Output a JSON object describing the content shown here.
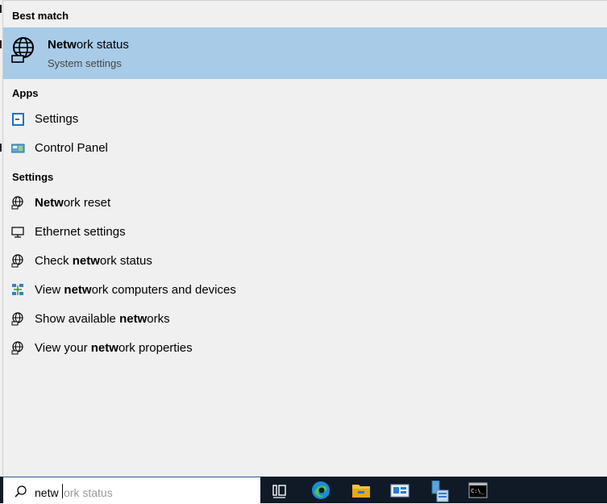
{
  "sections": {
    "best_match": "Best match",
    "apps": "Apps",
    "settings": "Settings"
  },
  "best_match": {
    "title_bold": "Netw",
    "title_rest": "ork status",
    "subtitle": "System settings"
  },
  "apps": [
    {
      "label": "Settings",
      "icon": "settings-app-icon"
    },
    {
      "label": "Control Panel",
      "icon": "control-panel-icon"
    }
  ],
  "settings": [
    {
      "pre": "",
      "bold": "Netw",
      "post": "ork reset",
      "icon": "globe-icon"
    },
    {
      "pre": "Ethernet settings",
      "bold": "",
      "post": "",
      "icon": "ethernet-icon"
    },
    {
      "pre": "Check ",
      "bold": "netw",
      "post": "ork status",
      "icon": "globe-icon"
    },
    {
      "pre": "View ",
      "bold": "netw",
      "post": "ork computers and devices",
      "icon": "network-devices-icon"
    },
    {
      "pre": "Show available ",
      "bold": "netw",
      "post": "orks",
      "icon": "globe-icon"
    },
    {
      "pre": "View your ",
      "bold": "netw",
      "post": "ork properties",
      "icon": "globe-icon"
    }
  ],
  "search": {
    "typed": "netw",
    "suggestion": "ork status"
  },
  "taskbar": [
    "task-view-icon",
    "edge-icon",
    "file-explorer-icon",
    "server-manager-icon",
    "admin-tools-icon",
    "terminal-icon"
  ]
}
